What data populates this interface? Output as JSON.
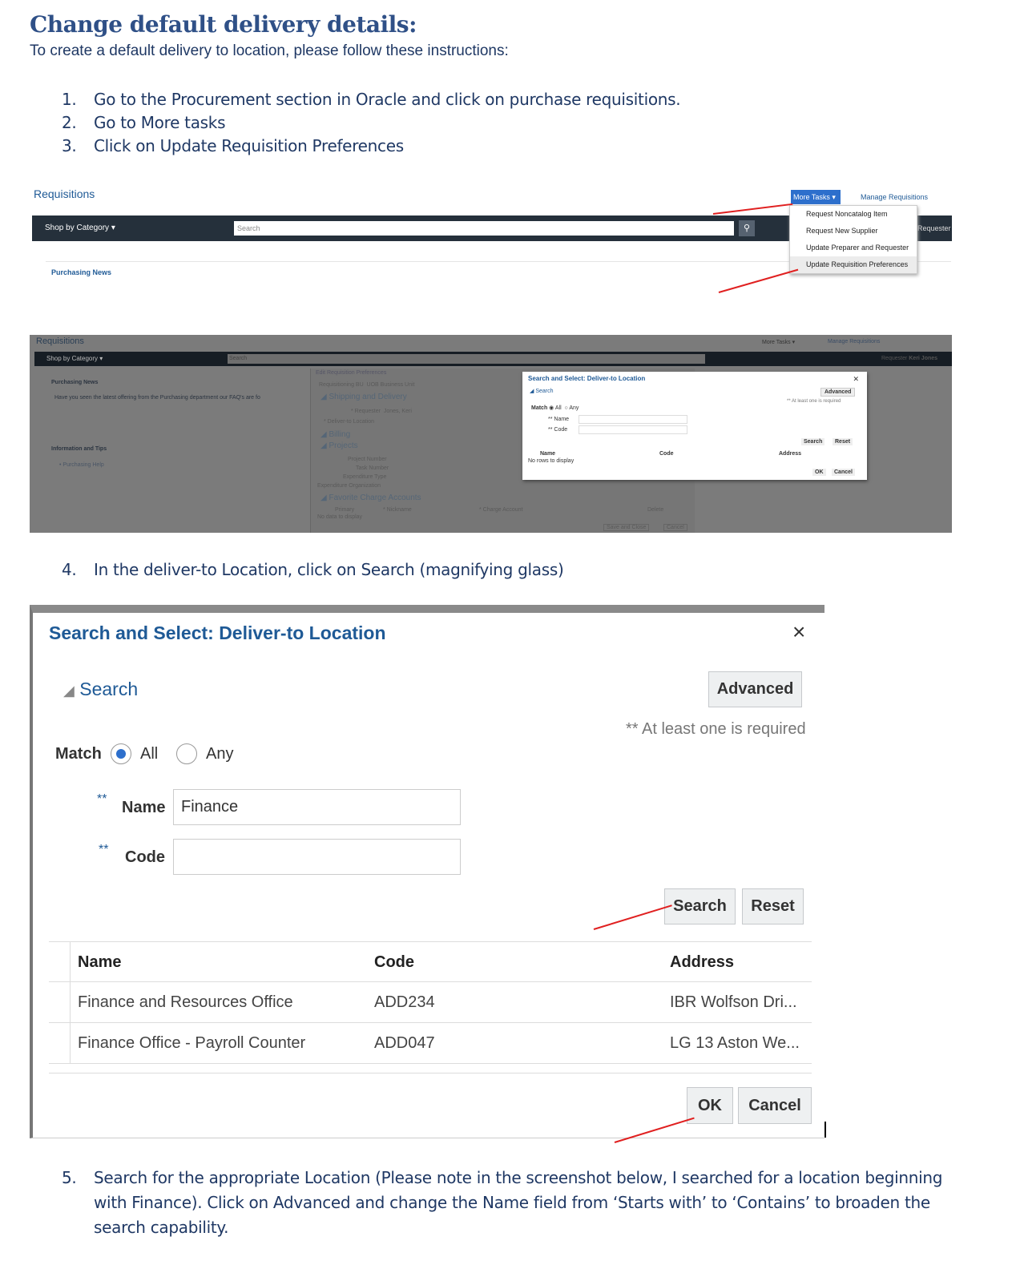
{
  "doc": {
    "title": "Change default delivery details:",
    "intro": "To create a default delivery to location, please follow these instructions:",
    "steps": [
      {
        "n": "1.",
        "text": "Go to the Procurement section in Oracle and click on purchase requisitions."
      },
      {
        "n": "2.",
        "text": "Go to More tasks"
      },
      {
        "n": "3.",
        "text": "Click on Update Requisition Preferences"
      },
      {
        "n": "4.",
        "text": "In the deliver-to Location, click on Search (magnifying glass)"
      },
      {
        "n": "5.",
        "text": "Search for the appropriate Location (Please note in the screenshot below, I searched for a location beginning with Finance). Click on Advanced and change the Name field from ‘Starts with’ to ‘Contains’ to broaden the search capability."
      }
    ]
  },
  "shot1": {
    "page_title": "Requisitions",
    "shop_by": "Shop by Category",
    "search_placeholder": "Search",
    "more_tasks": "More Tasks",
    "manage": "Manage Requisitions",
    "requester": "Requester",
    "news": "Purchasing News",
    "menu": [
      "Request Noncatalog Item",
      "Request New Supplier",
      "Update Preparer and Requester",
      "Update Requisition Preferences"
    ]
  },
  "shot2": {
    "page_title": "Requisitions",
    "shop_by": "Shop by Category",
    "search_placeholder": "Search",
    "more_tasks": "More Tasks",
    "manage": "Manage Requisitions",
    "requester": "Requester",
    "requester_name": "Keri Jones",
    "news": "Purchasing News",
    "news_text": "Have you seen the latest offering from the Purchasing department our FAQ's are fo",
    "info": "Information and Tips",
    "help": "Purchasing Help",
    "edit": {
      "title": "Edit Requisition Preferences",
      "bu_label": "Requisitioning BU",
      "bu": "UOB Business Unit",
      "shipping": "Shipping and Delivery",
      "requester_label": "* Requester",
      "requester": "Jones, Keri",
      "deliver_label": "* Deliver-to Location",
      "billing": "Billing",
      "projects": "Projects",
      "project_number": "Project Number",
      "task_number": "Task Number",
      "exp_type": "Expenditure Type",
      "exp_org": "Expenditure Organization",
      "fav": "Favorite Charge Accounts",
      "primary": "Primary",
      "nickname": "* Nickname",
      "charge": "* Charge Account",
      "delete": "Delete",
      "nodata": "No data to display",
      "save": "Save and Close",
      "cancel": "Cancel"
    },
    "dialog": {
      "title": "Search and Select: Deliver-to Location",
      "search": "Search",
      "advanced": "Advanced",
      "required": "** At least one is required",
      "match": "Match",
      "all": "All",
      "any": "Any",
      "name": "** Name",
      "code": "** Code",
      "search_btn": "Search",
      "reset": "Reset",
      "cols": [
        "Name",
        "Code",
        "Address"
      ],
      "norows": "No rows to display",
      "ok": "OK",
      "cancel": "Cancel"
    }
  },
  "shot3": {
    "title": "Search and Select: Deliver-to Location",
    "close": "×",
    "search": "Search",
    "advanced": "Advanced",
    "required": "** At least one is required",
    "match": "Match",
    "all": "All",
    "any": "Any",
    "req_mark": "**",
    "name_label": "Name",
    "name_value": "Finance",
    "code_label": "Code",
    "code_value": "",
    "search_btn": "Search",
    "reset": "Reset",
    "cols": [
      "Name",
      "Code",
      "Address"
    ],
    "rows": [
      {
        "name": "Finance and Resources Office",
        "code": "ADD234",
        "address": "IBR Wolfson Dri..."
      },
      {
        "name": "Finance Office - Payroll Counter",
        "code": "ADD047",
        "address": "LG 13 Aston We..."
      }
    ],
    "ok": "OK",
    "cancel": "Cancel"
  },
  "colors": {
    "heading": "#2f5087",
    "text": "#1f3864",
    "oracle_bar": "#25303b",
    "accent": "#2d6fcc",
    "dialog_title": "#1f5a96",
    "arrow": "#e02020"
  }
}
